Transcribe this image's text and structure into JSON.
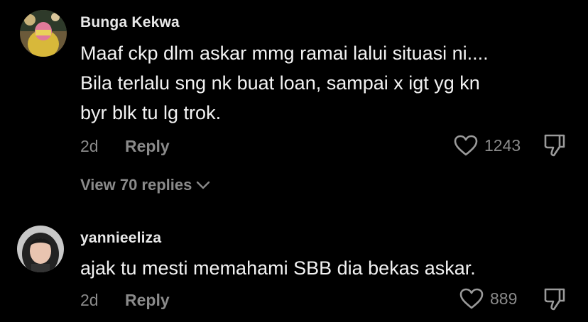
{
  "comments": [
    {
      "username": "Bunga Kekwa",
      "lines": [
        "Maaf ckp dlm askar mmg ramai lalui situasi ni....",
        "Bila terlalu sng nk buat loan, sampai x igt yg kn",
        "byr blk tu lg trok."
      ],
      "time": "2d",
      "reply_label": "Reply",
      "likes": "1243",
      "view_replies": "View 70 replies"
    },
    {
      "username": "yannieeliza",
      "lines": [
        "ajak tu mesti memahami SBB dia bekas askar."
      ],
      "time": "2d",
      "reply_label": "Reply",
      "likes": "889"
    }
  ],
  "icons": {
    "like": "heart-outline-icon",
    "dislike": "thumbs-down-icon",
    "expand": "chevron-down-icon"
  },
  "colors": {
    "background": "#000000",
    "text": "#f2f2f2",
    "muted": "#8a8a8a"
  }
}
